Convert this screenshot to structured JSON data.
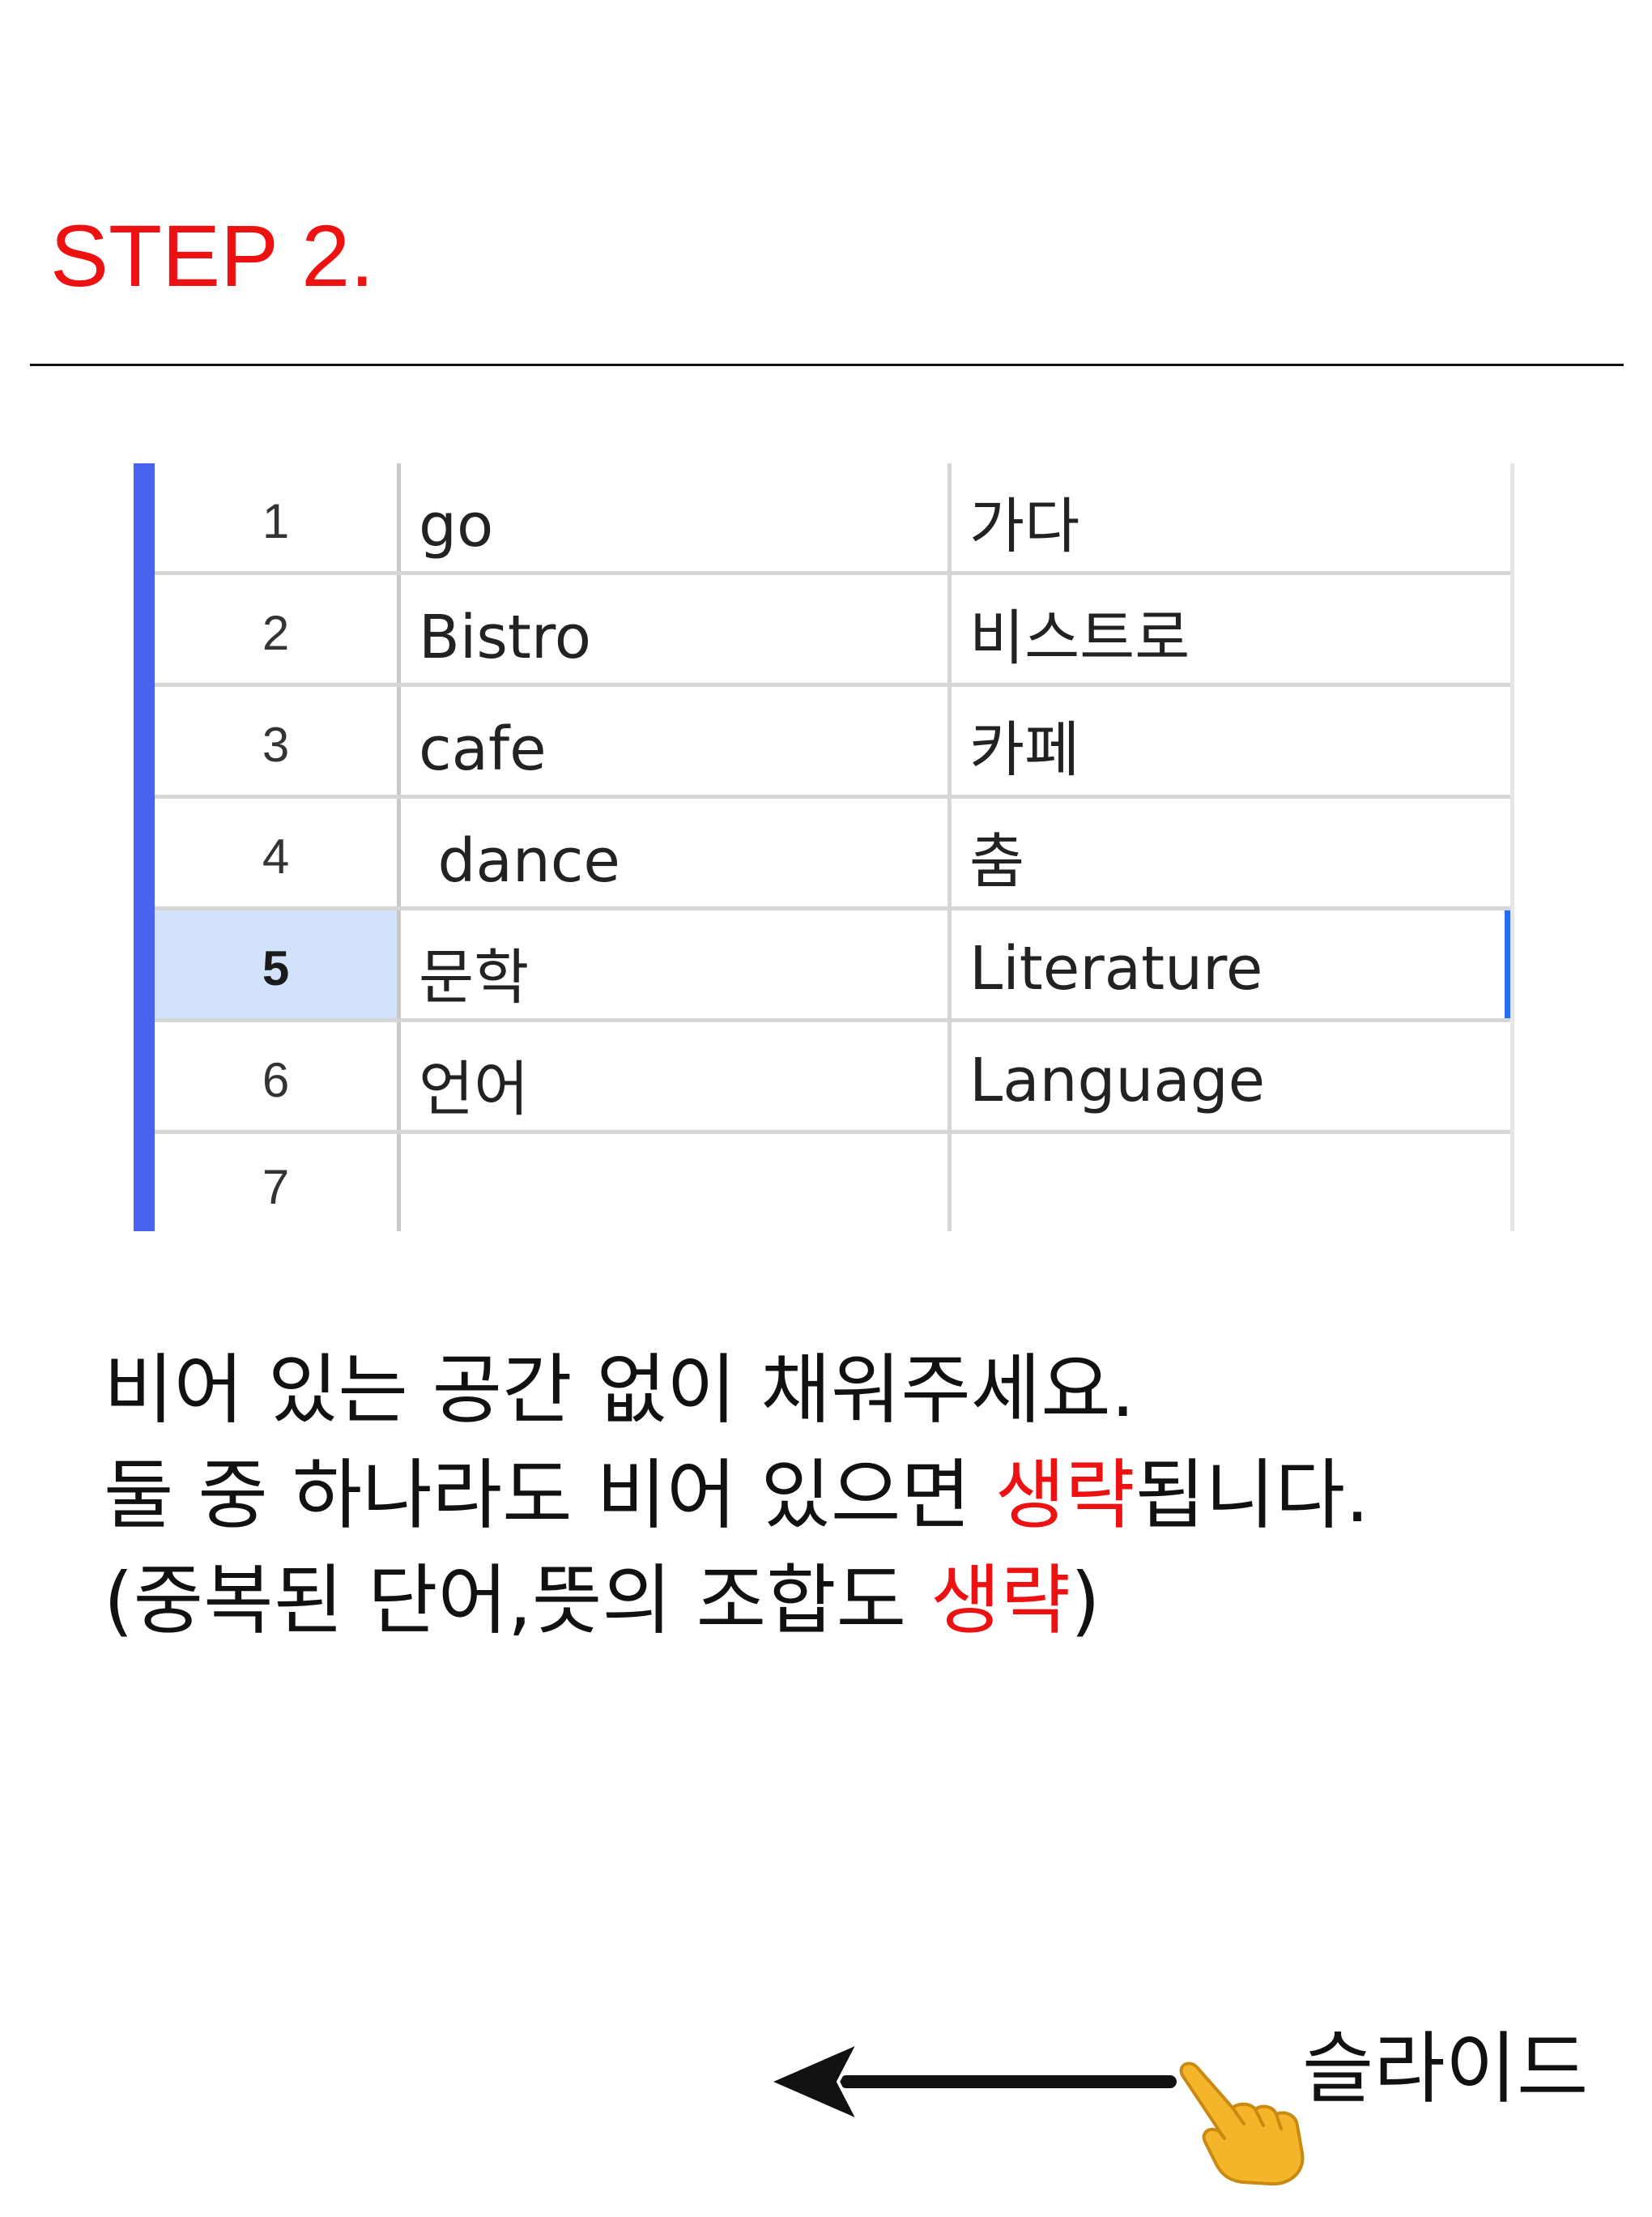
{
  "step_title": "STEP 2.",
  "sheet": {
    "rows": [
      {
        "num": "1",
        "word": "go",
        "meaning": "가다",
        "selected": false
      },
      {
        "num": "2",
        "word": "Bistro",
        "meaning": "비스트로",
        "selected": false
      },
      {
        "num": "3",
        "word": "cafe",
        "meaning": "카페",
        "selected": false
      },
      {
        "num": "4",
        "word": " dance",
        "meaning": "춤",
        "selected": false
      },
      {
        "num": "5",
        "word": "문학",
        "meaning": "Literature",
        "selected": true
      },
      {
        "num": "6",
        "word": "언어",
        "meaning": "Language",
        "selected": false
      },
      {
        "num": "7",
        "word": "",
        "meaning": "",
        "selected": false
      }
    ]
  },
  "notes": {
    "line1": "비어 있는 공간 없이 채워주세요.",
    "line2_pre": "둘 중 하나라도 비어 있으면 ",
    "line2_red": "생략",
    "line2_post": "됩니다.",
    "line3_pre": "(중복된 단어,뜻의 조합도 ",
    "line3_red": "생략",
    "line3_post": ")"
  },
  "slide_hint": {
    "label": "슬라이드",
    "arrow_icon": "left-arrow-icon",
    "pointer_icon": "pointing-hand-icon"
  },
  "colors": {
    "accent_red": "#ee1111",
    "sheet_left_bar": "#4a62f0",
    "selected_row_bg": "#d3e2fb",
    "selected_cell_edge": "#2a6cf0",
    "hand": "#f5b52a"
  }
}
